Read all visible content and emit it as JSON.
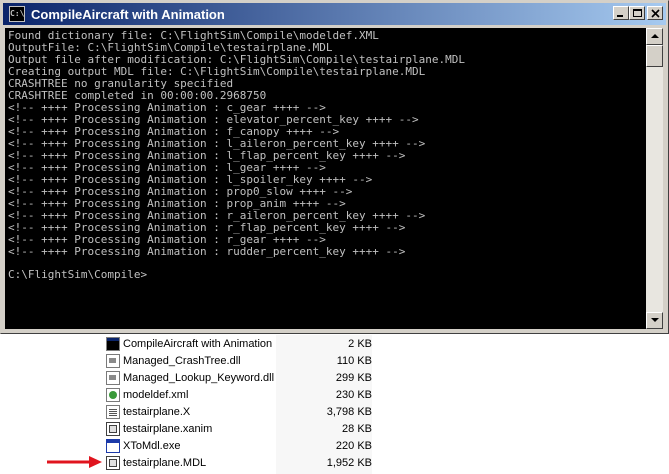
{
  "window": {
    "title": "CompileAircraft with Animation",
    "icon": "console-icon",
    "buttons": [
      "minimize",
      "maximize",
      "close"
    ]
  },
  "console": {
    "lines": [
      "Found dictionary file: C:\\FlightSim\\Compile\\modeldef.XML",
      "OutputFile: C:\\FlightSim\\Compile\\testairplane.MDL",
      "Output file after modification: C:\\FlightSim\\Compile\\testairplane.MDL",
      "Creating output MDL file: C:\\FlightSim\\Compile\\testairplane.MDL",
      "CRASHTREE no granularity specified",
      "CRASHTREE completed in 00:00:00.2968750",
      "<!-- ++++ Processing Animation : c_gear ++++ -->",
      "<!-- ++++ Processing Animation : elevator_percent_key ++++ -->",
      "<!-- ++++ Processing Animation : f_canopy ++++ -->",
      "<!-- ++++ Processing Animation : l_aileron_percent_key ++++ -->",
      "<!-- ++++ Processing Animation : l_flap_percent_key ++++ -->",
      "<!-- ++++ Processing Animation : l_gear ++++ -->",
      "<!-- ++++ Processing Animation : l_spoiler_key ++++ -->",
      "<!-- ++++ Processing Animation : prop0_slow ++++ -->",
      "<!-- ++++ Processing Animation : prop_anim ++++ -->",
      "<!-- ++++ Processing Animation : r_aileron_percent_key ++++ -->",
      "<!-- ++++ Processing Animation : r_flap_percent_key ++++ -->",
      "<!-- ++++ Processing Animation : r_gear ++++ -->",
      "<!-- ++++ Processing Animation : rudder_percent_key ++++ -->"
    ],
    "prompt": "C:\\FlightSim\\Compile>"
  },
  "files": [
    {
      "name": "CompileAircraft with Animation",
      "size": "2 KB",
      "icon": "console-shortcut-icon"
    },
    {
      "name": "Managed_CrashTree.dll",
      "size": "110 KB",
      "icon": "dll-icon"
    },
    {
      "name": "Managed_Lookup_Keyword.dll",
      "size": "299 KB",
      "icon": "dll-icon"
    },
    {
      "name": "modeldef.xml",
      "size": "230 KB",
      "icon": "xml-icon"
    },
    {
      "name": "testairplane.X",
      "size": "3,798 KB",
      "icon": "text-file-icon"
    },
    {
      "name": "testairplane.xanim",
      "size": "28 KB",
      "icon": "document-icon"
    },
    {
      "name": "XToMdl.exe",
      "size": "220 KB",
      "icon": "exe-icon"
    },
    {
      "name": "testairplane.MDL",
      "size": "1,952 KB",
      "icon": "document-icon"
    }
  ],
  "highlight": {
    "file": "testairplane.MDL",
    "arrow_color": "#e0141e"
  },
  "colors": {
    "titlebar_start": "#0a246a",
    "titlebar_end": "#a6caf0",
    "console_bg": "#000000",
    "console_text": "#c0c0c0"
  }
}
